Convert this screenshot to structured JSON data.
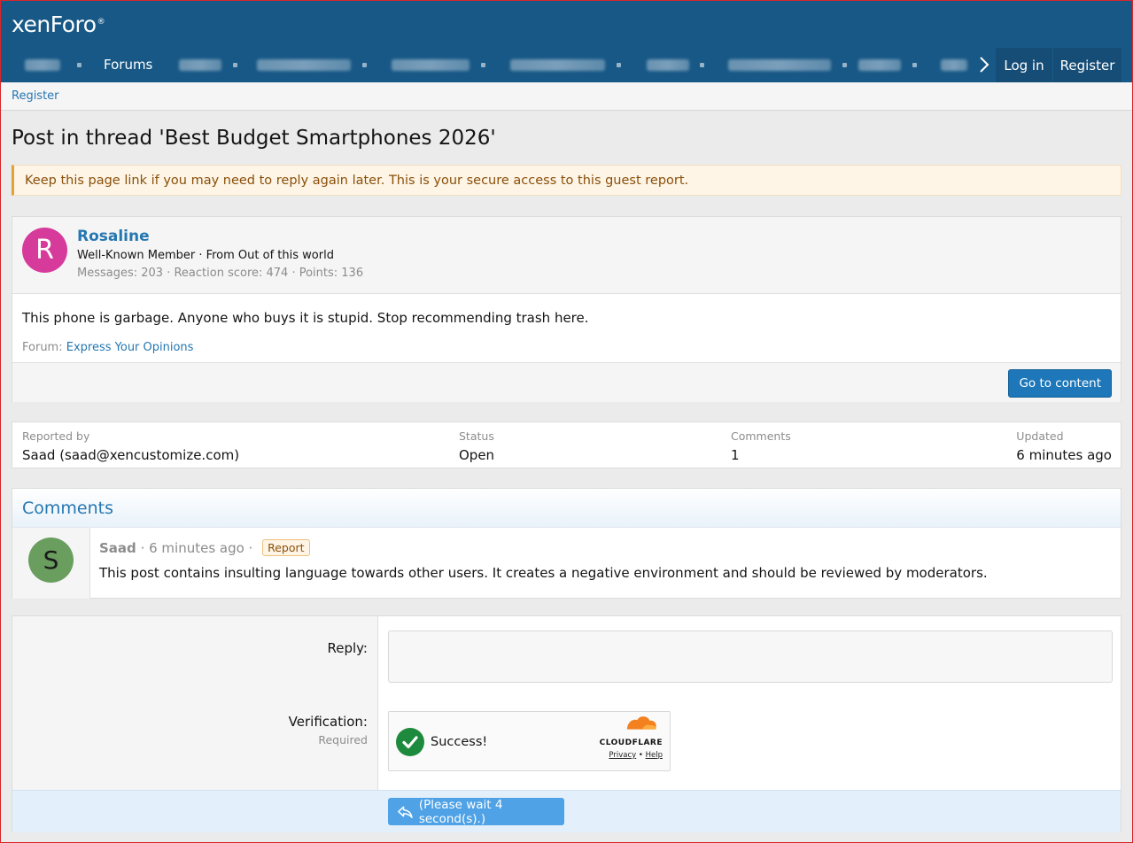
{
  "header": {
    "logo_text": "xenForo",
    "logo_mark": "®",
    "nav_forums": "Forums",
    "login": "Log in",
    "register": "Register"
  },
  "breadcrumb": {
    "register": "Register"
  },
  "page_title": "Post in thread 'Best Budget Smartphones 2026'",
  "notice": "Keep this page link if you may need to reply again later. This is your secure access to this guest report.",
  "post": {
    "avatar_letter": "R",
    "username": "Rosaline",
    "user_title": "Well-Known Member · From Out of this world",
    "stats": "Messages: 203 · Reaction score: 474 · Points: 136",
    "text": "This phone is garbage. Anyone who buys it is stupid. Stop recommending trash here.",
    "forum_prefix": "Forum:",
    "forum_name": "Express Your Opinions",
    "go_to_content": "Go to content"
  },
  "report_info": {
    "reported_by_label": "Reported by",
    "reported_by_value": "Saad (saad@xencustomize.com)",
    "status_label": "Status",
    "status_value": "Open",
    "comments_label": "Comments",
    "comments_value": "1",
    "updated_label": "Updated",
    "updated_value": "6 minutes ago"
  },
  "comments": {
    "heading": "Comments",
    "items": [
      {
        "avatar_letter": "S",
        "user": "Saad",
        "time": " · 6 minutes ago · ",
        "badge": "Report",
        "text": "This post contains insulting language towards other users. It creates a negative environment and should be reviewed by moderators."
      }
    ]
  },
  "reply_form": {
    "reply_label": "Reply:",
    "verification_label": "Verification:",
    "verification_required": "Required",
    "captcha_status": "Success!",
    "captcha_brand": "CLOUDFLARE",
    "captcha_privacy": "Privacy",
    "captcha_sep": " • ",
    "captcha_help": "Help",
    "submit_label": "(Please wait 4 second(s).)"
  },
  "colors": {
    "header_bg": "#185886",
    "link": "#2577b1",
    "primary_button": "#1e77b9",
    "avatar_r": "#d63a9a",
    "avatar_s": "#6a9e5f",
    "success": "#1e8a3e",
    "cloudflare_orange": "#f48120"
  }
}
